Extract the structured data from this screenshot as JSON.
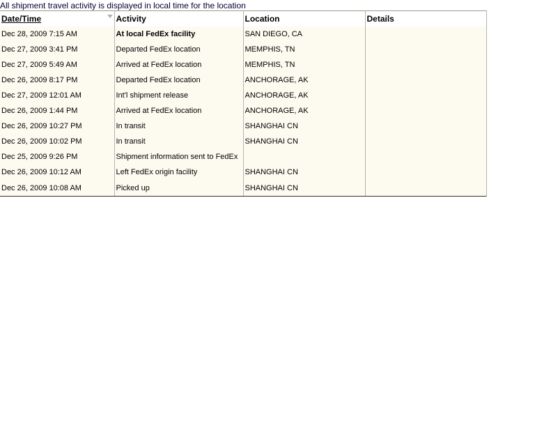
{
  "note": "All shipment travel activity is displayed in local time for the location",
  "table": {
    "headers": {
      "date": "Date/Time",
      "activity": "Activity",
      "location": "Location",
      "details": "Details"
    },
    "rows": [
      {
        "date": "Dec 28, 2009 7:15 AM",
        "activity": "At local FedEx facility",
        "location": "SAN DIEGO, CA",
        "details": ""
      },
      {
        "date": "Dec 27, 2009 3:41 PM",
        "activity": "Departed FedEx location",
        "location": "MEMPHIS, TN",
        "details": ""
      },
      {
        "date": "Dec 27, 2009 5:49 AM",
        "activity": "Arrived at FedEx location",
        "location": "MEMPHIS, TN",
        "details": ""
      },
      {
        "date": "Dec 26, 2009 8:17 PM",
        "activity": "Departed FedEx location",
        "location": "ANCHORAGE, AK",
        "details": ""
      },
      {
        "date": "Dec 27, 2009 12:01 AM",
        "activity": "Int'l shipment release",
        "location": "ANCHORAGE, AK",
        "details": ""
      },
      {
        "date": "Dec 26, 2009 1:44 PM",
        "activity": "Arrived at FedEx location",
        "location": "ANCHORAGE, AK",
        "details": ""
      },
      {
        "date": "Dec 26, 2009 10:27 PM",
        "activity": "In transit",
        "location": "SHANGHAI CN",
        "details": ""
      },
      {
        "date": "Dec 26, 2009 10:02 PM",
        "activity": "In transit",
        "location": "SHANGHAI CN",
        "details": ""
      },
      {
        "date": "Dec 25, 2009 9:26 PM",
        "activity": "Shipment information sent to FedEx",
        "location": "",
        "details": ""
      },
      {
        "date": "Dec 26, 2009 10:12 AM",
        "activity": "Left FedEx origin facility",
        "location": "SHANGHAI CN",
        "details": ""
      },
      {
        "date": "Dec 26, 2009 10:08 AM",
        "activity": "Picked up",
        "location": "SHANGHAI CN",
        "details": ""
      }
    ]
  },
  "icons": {
    "sort": "sort-descending-icon"
  },
  "colors": {
    "row_background": "#fdfaf0",
    "note_text": "#000033",
    "grid_line": "#b5b5a5"
  }
}
